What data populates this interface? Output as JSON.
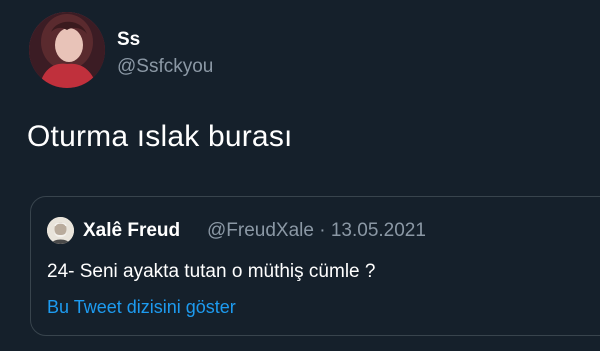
{
  "tweet": {
    "author": {
      "name": "Ss",
      "handle": "@Ssfckyou"
    },
    "text": "Oturma ıslak burası"
  },
  "quoted_tweet": {
    "author_name": "Xalê Freud",
    "handle": "@FreudXale",
    "separator": "·",
    "date": "13.05.2021",
    "text": "24- Seni ayakta tutan o müthiş cümle ?",
    "thread_link_label": "Bu Tweet dizisini göster"
  },
  "colors": {
    "background": "#15202b",
    "secondary_text": "#8b98a5",
    "link": "#1d9bf0",
    "border": "#38444d"
  }
}
